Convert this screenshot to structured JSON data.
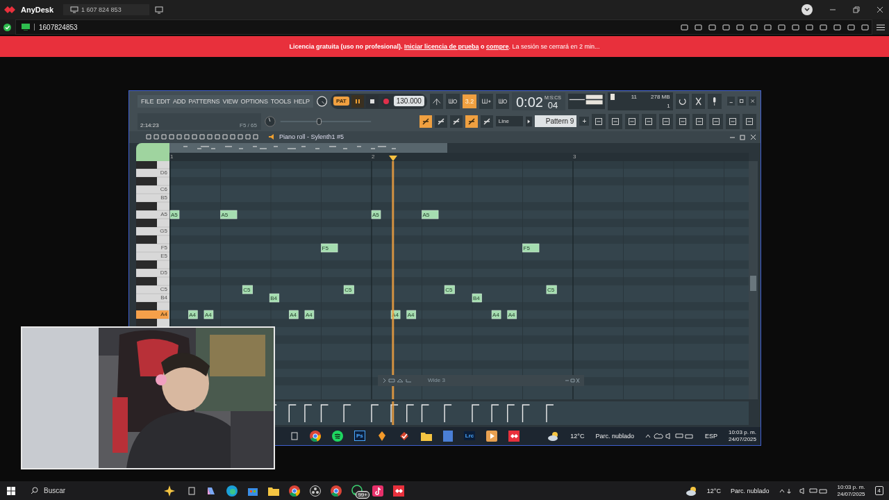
{
  "anydesk": {
    "app_name": "AnyDesk",
    "tab_label": "1 607 824 853",
    "address": "1607824853"
  },
  "banner": {
    "lead": "Licencia gratuita (uso no profesional).",
    "link_1": "Iniciar licencia de prueba",
    "middle": "o",
    "link_2": "compre",
    "tail": ". La sesión se cerrará en 2 min..."
  },
  "fl": {
    "menu": [
      "FILE",
      "EDIT",
      "ADD",
      "PATTERNS",
      "VIEW",
      "OPTIONS",
      "TOOLS",
      "HELP"
    ],
    "pat_label": "PAT",
    "tempo": "130.000",
    "metronome": {
      "label": "3.2",
      "on": true
    },
    "time": "0:02",
    "time_cs": "04",
    "time_format": "M:S:CS",
    "cpu": "11",
    "memory": "278 MB",
    "polyphony": "1",
    "song_position": "2:14:23",
    "hint": "F5 / 65",
    "master_slider": {
      "level": 0.42
    },
    "snap": "Line",
    "pattern": "Pattern 9",
    "pattern_add": "+",
    "toggles": [
      {
        "on": true
      },
      {
        "on": false
      },
      {
        "on": false
      },
      {
        "on": true
      },
      {
        "on": false
      }
    ]
  },
  "piano_roll": {
    "title": "Piano roll - Sylenth1 #5",
    "bar_numbers": [
      "1",
      "2",
      "3"
    ],
    "keys": [
      {
        "label": "D6",
        "selected": false
      },
      {
        "label": "C6",
        "selected": false
      },
      {
        "label": "B5",
        "selected": false
      },
      {
        "label": "A5",
        "selected": false
      },
      {
        "label": "G5",
        "selected": false
      },
      {
        "label": "F5",
        "selected": false
      },
      {
        "label": "E5",
        "selected": false
      },
      {
        "label": "D5",
        "selected": false
      },
      {
        "label": "C5",
        "selected": false
      },
      {
        "label": "B4",
        "selected": false
      },
      {
        "label": "A4",
        "selected": true
      }
    ],
    "notes": [
      {
        "label": "A5"
      },
      {
        "label": "A5"
      },
      {
        "label": "A5"
      },
      {
        "label": "A5"
      },
      {
        "label": "F5"
      },
      {
        "label": "F5"
      },
      {
        "label": "C5"
      },
      {
        "label": "C5"
      },
      {
        "label": "C5"
      },
      {
        "label": "C5"
      },
      {
        "label": "B4"
      },
      {
        "label": "B4"
      },
      {
        "label": "A4"
      },
      {
        "label": "A4"
      },
      {
        "label": "A4"
      },
      {
        "label": "A4"
      },
      {
        "label": "A4"
      },
      {
        "label": "A4"
      },
      {
        "label": "A4"
      },
      {
        "label": "A4"
      }
    ]
  },
  "plugin_window": {
    "title": "Wide 3"
  },
  "remote_taskbar": {
    "photoshop_label": "Ps",
    "lightroom_label": "Lrc",
    "weather_temp": "12°C",
    "weather_text": "Parc. nublado",
    "language": "ESP",
    "time": "10:03 p. m.",
    "date": "24/07/2025"
  },
  "taskbar": {
    "search_placeholder": "Buscar",
    "whatsapp_badge": "99+",
    "weather_temp": "12°C",
    "weather_text": "Parc. nublado",
    "time": "10:03 p. m.",
    "date": "24/07/2025",
    "notification_count": "4"
  }
}
